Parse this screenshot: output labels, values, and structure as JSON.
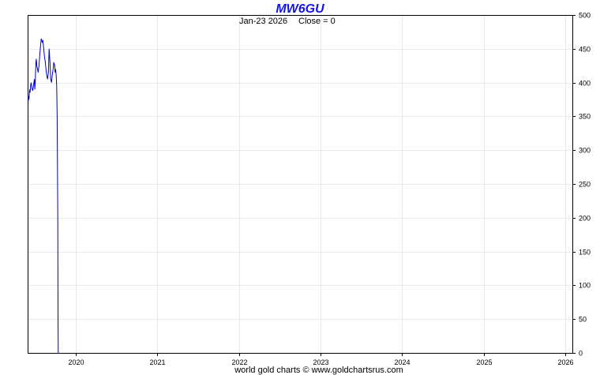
{
  "chart_data": {
    "type": "line",
    "title": "MW6GU",
    "subtitle_date": "Jan-23  2026",
    "subtitle_close": "Close = 0",
    "footer": "world gold charts © www.goldchartsrus.com",
    "ylim": [
      0,
      500
    ],
    "y_ticks": [
      0,
      50,
      100,
      150,
      200,
      250,
      300,
      350,
      400,
      450,
      500
    ],
    "x_ticks": [
      "2020",
      "2021",
      "2022",
      "2023",
      "2024",
      "2025",
      "2026"
    ],
    "x_range": [
      "2019-06-01",
      "2026-02-01"
    ],
    "grid": true,
    "line_color": "#0000cc",
    "series": [
      {
        "x": [
          "2019-06-03",
          "2019-06-05",
          "2019-06-07",
          "2019-06-10",
          "2019-06-12",
          "2019-06-14",
          "2019-06-17",
          "2019-06-20",
          "2019-06-24",
          "2019-06-27",
          "2019-07-01",
          "2019-07-03",
          "2019-07-05",
          "2019-07-08",
          "2019-07-10",
          "2019-07-12",
          "2019-07-15",
          "2019-07-18",
          "2019-07-22",
          "2019-07-25",
          "2019-07-29",
          "2019-08-01",
          "2019-08-05",
          "2019-08-08",
          "2019-08-12",
          "2019-08-15",
          "2019-08-19",
          "2019-08-22",
          "2019-08-26",
          "2019-08-29",
          "2019-09-02",
          "2019-09-05",
          "2019-09-09",
          "2019-09-12",
          "2019-09-16",
          "2019-09-19",
          "2019-09-23",
          "2019-09-26",
          "2019-09-30",
          "2019-10-02",
          "2019-10-04",
          "2019-10-07",
          "2019-10-09",
          "2019-10-11",
          "2019-10-14",
          "2019-10-15",
          "2019-10-16"
        ],
        "values": [
          370,
          380,
          375,
          390,
          385,
          395,
          400,
          392,
          388,
          395,
          405,
          390,
          400,
          430,
          435,
          425,
          420,
          415,
          425,
          440,
          455,
          465,
          460,
          462,
          450,
          440,
          430,
          420,
          410,
          405,
          415,
          450,
          430,
          405,
          400,
          410,
          420,
          430,
          425,
          415,
          420,
          410,
          395,
          350,
          200,
          50,
          0
        ]
      }
    ]
  }
}
